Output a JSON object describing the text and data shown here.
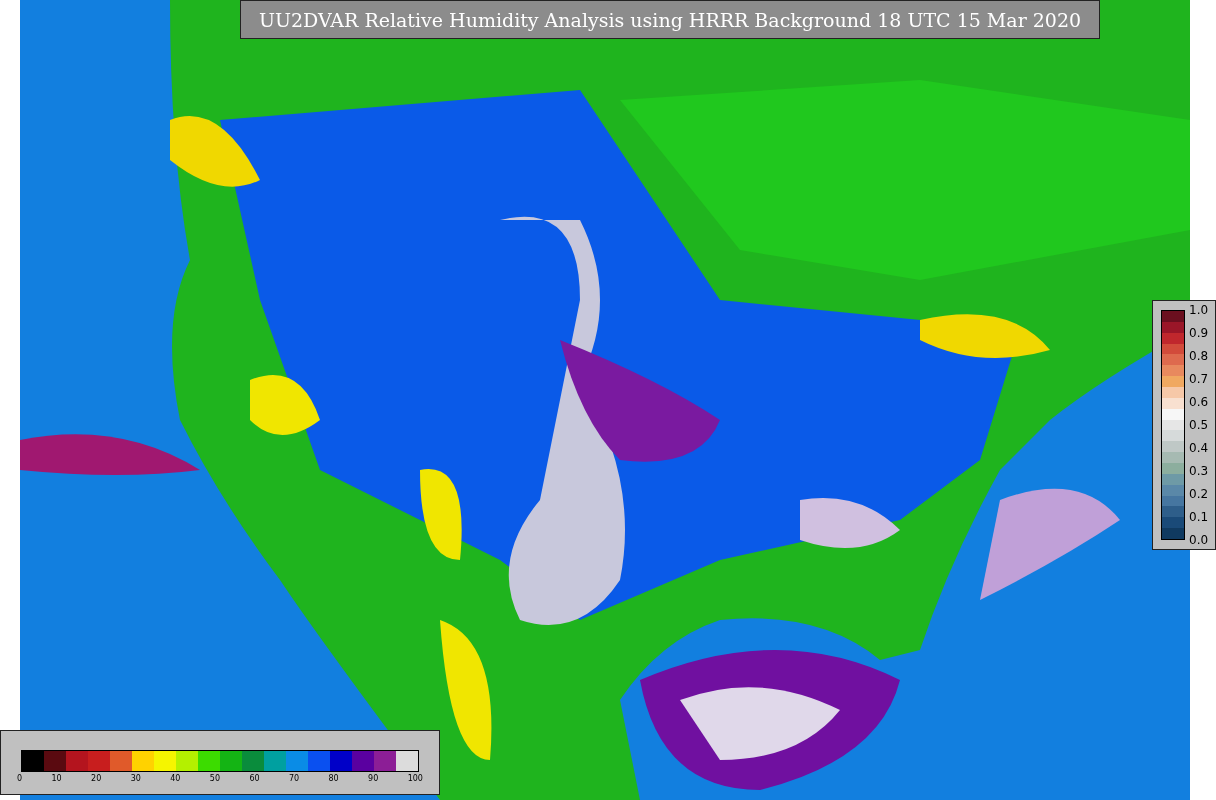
{
  "title": "UU2DVAR Relative Humidity Analysis using HRRR Background 18 UTC 15 Mar 2020",
  "error_colorbar": {
    "segments": [
      {
        "color": "#6b0f1f"
      },
      {
        "color": "#9a1628"
      },
      {
        "color": "#c0272d"
      },
      {
        "color": "#d24b3b"
      },
      {
        "color": "#de6a4e"
      },
      {
        "color": "#e8895e"
      },
      {
        "color": "#f0a860"
      },
      {
        "color": "#f6c8a8"
      },
      {
        "color": "#f8e0d0"
      },
      {
        "color": "#f7f7f7"
      },
      {
        "color": "#e6e6e6"
      },
      {
        "color": "#d6dada"
      },
      {
        "color": "#bfc8c6"
      },
      {
        "color": "#a6bab2"
      },
      {
        "color": "#8cae9e"
      },
      {
        "color": "#6e9aa6"
      },
      {
        "color": "#5a88a8"
      },
      {
        "color": "#4676a0"
      },
      {
        "color": "#2e5e8a"
      },
      {
        "color": "#1a4a78"
      },
      {
        "color": "#103a60"
      }
    ],
    "ticks": [
      "1.0",
      "0.9",
      "0.8",
      "0.7",
      "0.6",
      "0.5",
      "0.4",
      "0.3",
      "0.2",
      "0.1",
      "0.0"
    ]
  },
  "rh_colorbar": {
    "segments": [
      {
        "color": "#000000"
      },
      {
        "color": "#5a0a10"
      },
      {
        "color": "#b4141e"
      },
      {
        "color": "#c81e1e"
      },
      {
        "color": "#e05a2a"
      },
      {
        "color": "#ffd200"
      },
      {
        "color": "#f5f500"
      },
      {
        "color": "#b4f000"
      },
      {
        "color": "#3cdc00"
      },
      {
        "color": "#14b414"
      },
      {
        "color": "#0a8c3c"
      },
      {
        "color": "#00a0a0"
      },
      {
        "color": "#0a8ce6"
      },
      {
        "color": "#0a50f0"
      },
      {
        "color": "#0000c8"
      },
      {
        "color": "#5a00a0"
      },
      {
        "color": "#8c1e96"
      },
      {
        "color": "#dcdcdc"
      }
    ],
    "ticks": [
      "0",
      "10",
      "20",
      "30",
      "40",
      "50",
      "60",
      "70",
      "80",
      "90",
      "100"
    ]
  }
}
